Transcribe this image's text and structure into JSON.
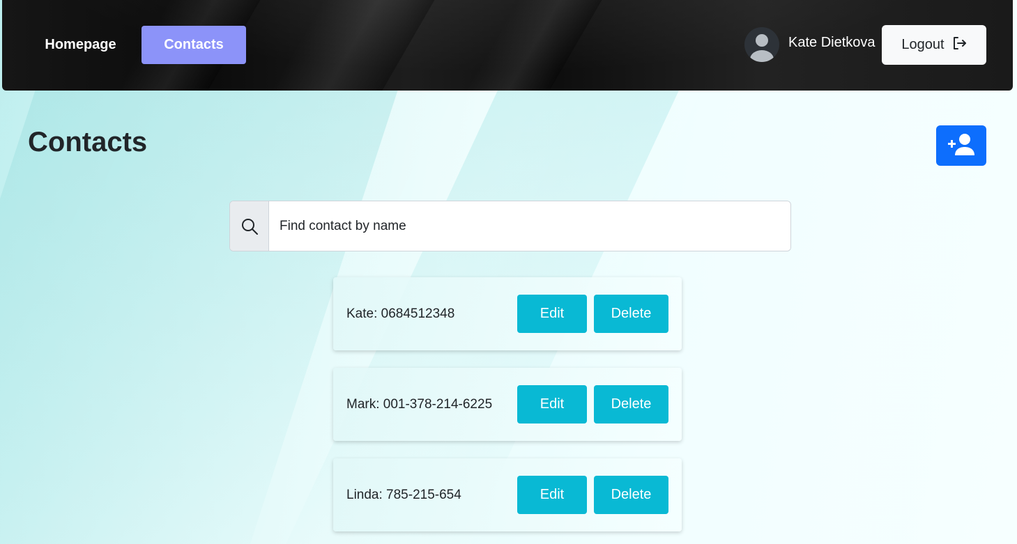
{
  "nav": {
    "links": [
      {
        "label": "Homepage"
      },
      {
        "label": "Contacts"
      }
    ],
    "user_name": "Kate Dietkova",
    "logout_label": "Logout"
  },
  "main": {
    "title": "Contacts",
    "search": {
      "placeholder": "Find contact by name",
      "value": ""
    },
    "contacts": [
      {
        "text": "Kate: 0684512348",
        "edit_label": "Edit",
        "delete_label": "Delete"
      },
      {
        "text": "Mark: 001-378-214-6225",
        "edit_label": "Edit",
        "delete_label": "Delete"
      },
      {
        "text": "Linda: 785-215-654",
        "edit_label": "Edit",
        "delete_label": "Delete"
      }
    ]
  },
  "icons": {
    "logout": "logout-icon",
    "add_contact": "person-plus-icon",
    "search": "search-icon",
    "avatar": "user-avatar-icon"
  },
  "colors": {
    "nav_active": "#8c93f9",
    "primary": "#0d6efd",
    "card_button": "#09b9d4",
    "navbar_bg": "#141414"
  }
}
